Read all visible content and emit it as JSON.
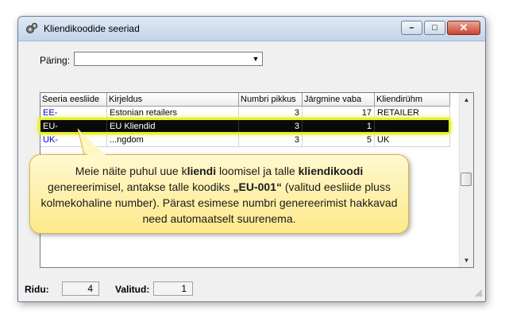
{
  "window": {
    "title": "Kliendikoodide seeriad",
    "buttons": {
      "minimize": "–",
      "maximize": "□",
      "close": "✕"
    }
  },
  "query": {
    "label": "Päring:",
    "value": ""
  },
  "table": {
    "columns": [
      "Seeria eesliide",
      "Kirjeldus",
      "Numbri pikkus",
      "Järgmine vaba",
      "Kliendirühm"
    ],
    "rows": [
      [
        "EE-",
        "Estonian retailers",
        "3",
        "17",
        "RETAILER"
      ],
      [
        "EU-",
        "EU Kliendid",
        "3",
        "1",
        ""
      ],
      [
        "UK-",
        "...ngdom",
        "3",
        "5",
        "UK"
      ]
    ],
    "selected_row": 1
  },
  "status": {
    "rows_label": "Ridu:",
    "rows_value": "4",
    "selected_label": "Valitud:",
    "selected_value": "1"
  },
  "callout": {
    "t1": "Meie näite puhul uue k",
    "t2": "liendi",
    "t3": " loomisel ja talle ",
    "t4": "kliendikoodi",
    "t5": "genereerimisel, antakse talle koodiks ",
    "t6": "„EU-001“",
    "t7": " (valitud eesliide pluss kolmekohaline number). Pärast esimese numbri genereerimist hakkavad need automaatselt suurenema."
  },
  "icons": {
    "app": "gears-icon",
    "dropdown": "chevron-down-icon",
    "scroll_up": "arrow-up-icon",
    "scroll_down": "arrow-down-icon",
    "grip": "resize-grip-icon"
  }
}
